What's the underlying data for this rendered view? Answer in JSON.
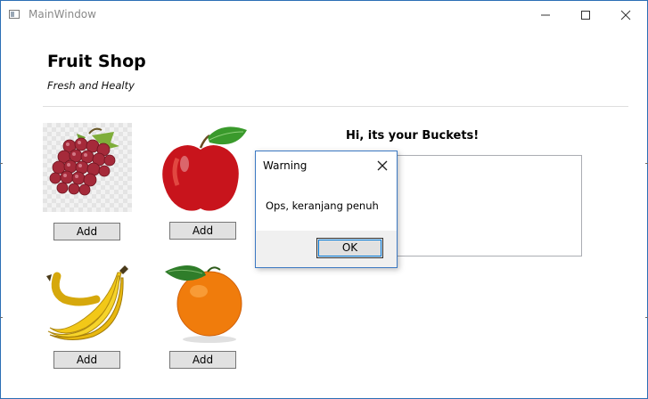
{
  "window": {
    "title": "MainWindow",
    "controls": [
      "minimize-icon",
      "maximize-icon",
      "close-icon"
    ]
  },
  "header": {
    "title": "Fruit Shop",
    "subtitle": "Fresh and Healty"
  },
  "products": [
    {
      "name": "grapes",
      "add_label": "Add"
    },
    {
      "name": "apple",
      "add_label": "Add"
    },
    {
      "name": "banana",
      "add_label": "Add"
    },
    {
      "name": "orange",
      "add_label": "Add"
    }
  ],
  "bucket": {
    "title": "Hi, its your Buckets!",
    "items": []
  },
  "dialog": {
    "title": "Warning",
    "message": "Ops, keranjang penuh",
    "ok_label": "OK"
  },
  "colors": {
    "window_border": "#2b6fb5",
    "button_face": "#e1e1e1",
    "dialog_footer": "#f0f0f0",
    "focus": "#0078d7"
  }
}
